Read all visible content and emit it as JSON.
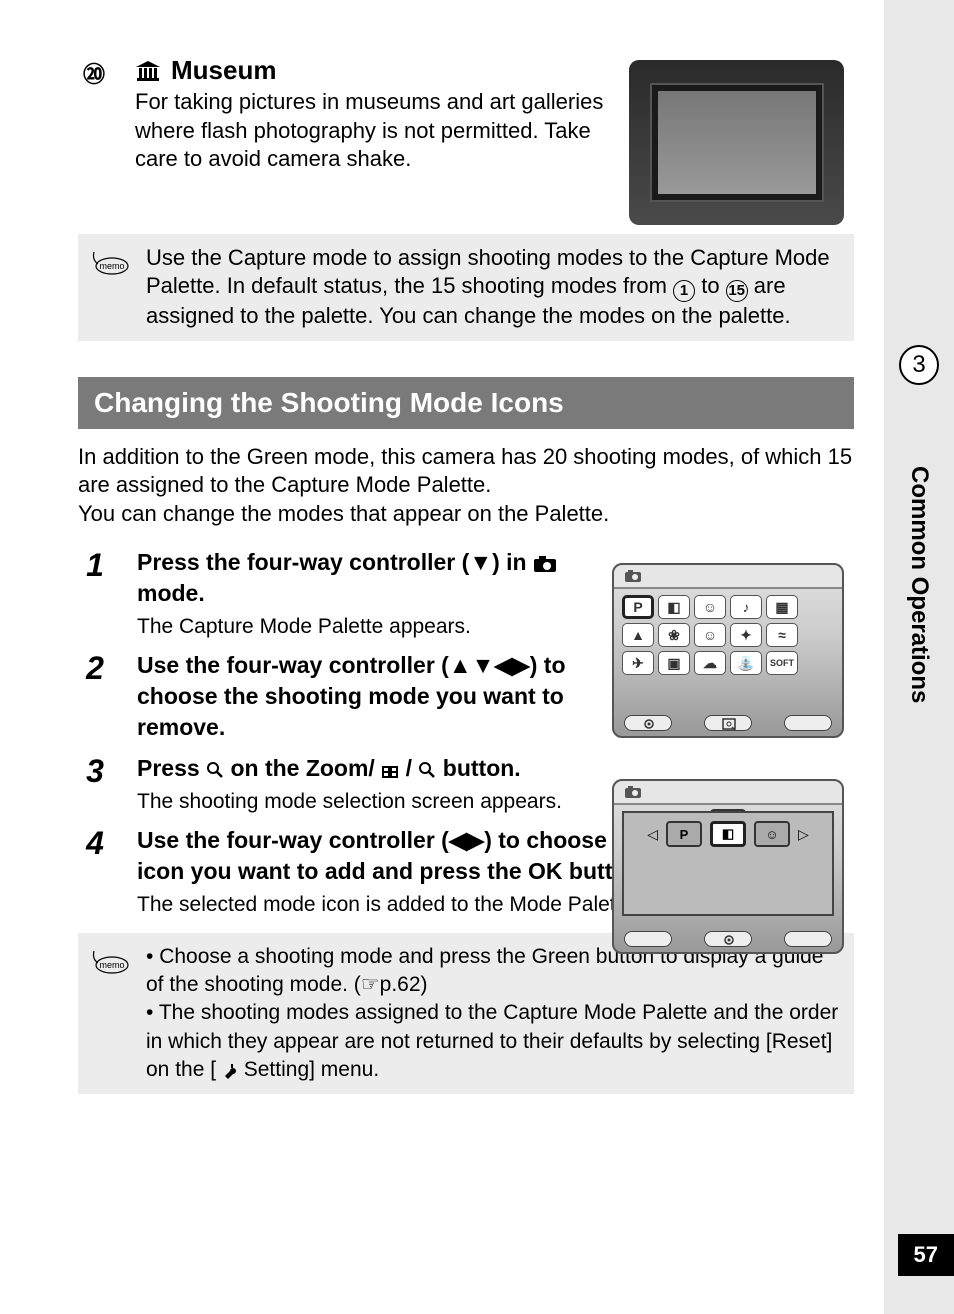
{
  "mode": {
    "number": "⑳",
    "title": "Museum",
    "description": "For taking pictures in museums and art galleries where flash photography is not permitted. Take care to avoid camera shake."
  },
  "memo1": {
    "pre": "Use the Capture mode to assign shooting modes to the Capture Mode Palette. In default status, the 15 shooting modes from ",
    "n1": "1",
    "mid": " to ",
    "n2": "15",
    "post": " are assigned to the palette. You can change the modes on the palette."
  },
  "section": {
    "title": "Changing the Shooting Mode Icons",
    "intro1": "In addition to the Green mode, this camera has 20 shooting modes, of which 15 are assigned to the Capture Mode Palette.",
    "intro2": "You can change the modes that appear on the Palette."
  },
  "steps": {
    "s1": {
      "num": "1",
      "title_pre": "Press the four-way controller (",
      "title_arrow": "▼",
      "title_mid": ") in ",
      "title_post": " mode.",
      "desc": "The Capture Mode Palette appears."
    },
    "s2": {
      "num": "2",
      "title_pre": "Use the four-way controller (",
      "title_arrows": "▲▼◀▶",
      "title_post": ") to choose the shooting mode you want to remove."
    },
    "s3": {
      "num": "3",
      "title_pre": "Press ",
      "title_mid": " on the Zoom/",
      "title_post1": "/",
      "title_post2": " button.",
      "desc": "The shooting mode selection screen appears."
    },
    "s4": {
      "num": "4",
      "title_pre": "Use the four-way controller (",
      "title_arrows": "◀▶",
      "title_mid": ") to choose the mode icon you want to add and press the ",
      "ok": "OK",
      "title_post": " button.",
      "desc": "The selected mode icon is added to the Mode Palette."
    }
  },
  "memo2": {
    "b1_pre": "Choose a shooting mode and press the Green button to display a guide of the shooting mode. (",
    "b1_ref": "☞p.62",
    "b1_post": ")",
    "b2_pre": "The shooting modes assigned to the Capture Mode Palette and the order in which they appear are not returned to their defaults by selecting [Reset] on the [",
    "b2_menu": " Setting] menu."
  },
  "lcd": {
    "p_label": "P",
    "soft_label": "SOFT"
  },
  "sidebar": {
    "chapter_num": "3",
    "chapter_label": "Common Operations"
  },
  "page_number": "57"
}
